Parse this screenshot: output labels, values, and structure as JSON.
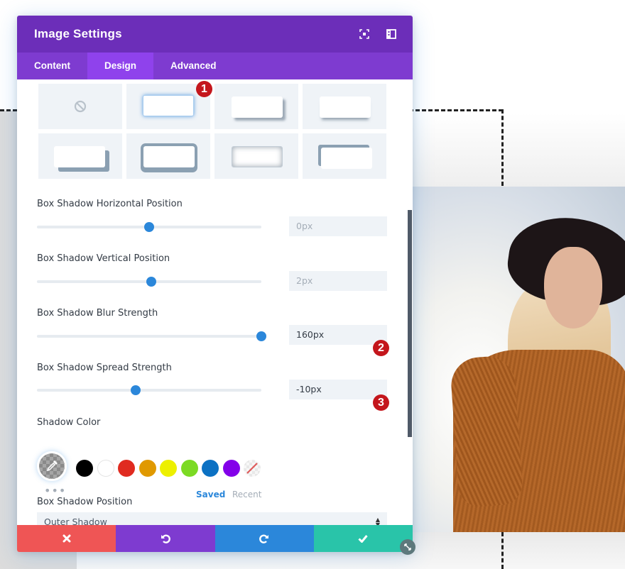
{
  "modal": {
    "title": "Image Settings",
    "header_icons": [
      "expand-icon",
      "split-view-icon"
    ],
    "tabs": [
      {
        "label": "Content",
        "active": false
      },
      {
        "label": "Design",
        "active": true
      },
      {
        "label": "Advanced",
        "active": false
      }
    ]
  },
  "box_shadow_presets": {
    "options": [
      "none",
      "glow",
      "drop-bottom-right",
      "drop-bottom",
      "solid-bottom-right",
      "solid-outline",
      "inset",
      "solid-top-left"
    ],
    "selected": "glow"
  },
  "annotations": [
    "1",
    "2",
    "3"
  ],
  "fields": {
    "horizontal": {
      "label": "Box Shadow Horizontal Position",
      "value": "0px",
      "slider_fraction": 0.5
    },
    "vertical": {
      "label": "Box Shadow Vertical Position",
      "value": "2px",
      "slider_fraction": 0.51
    },
    "blur": {
      "label": "Box Shadow Blur Strength",
      "value": "160px",
      "slider_fraction": 1.0
    },
    "spread": {
      "label": "Box Shadow Spread Strength",
      "value": "-10px",
      "slider_fraction": 0.44
    }
  },
  "shadow_color": {
    "label": "Shadow Color",
    "swatches": [
      {
        "name": "black",
        "color": "#000000"
      },
      {
        "name": "white",
        "color": "#ffffff"
      },
      {
        "name": "red",
        "color": "#e02b20"
      },
      {
        "name": "orange",
        "color": "#e09900"
      },
      {
        "name": "yellow",
        "color": "#edf000"
      },
      {
        "name": "green",
        "color": "#7cda24"
      },
      {
        "name": "blue",
        "color": "#0c71c3"
      },
      {
        "name": "purple",
        "color": "#8300e9"
      },
      {
        "name": "transparent",
        "color": "none"
      }
    ],
    "more_label": "•••",
    "palette_tabs": {
      "saved": "Saved",
      "recent": "Recent"
    }
  },
  "shadow_position": {
    "label": "Box Shadow Position",
    "selected": "Outer Shadow"
  },
  "footer": {
    "cancel": "cancel-icon",
    "undo": "undo-icon",
    "redo": "redo-icon",
    "save": "check-icon"
  },
  "colors": {
    "header": "#6c2eb9",
    "tabs": "#7e3bd0",
    "active_tab": "#8f42ec",
    "accent_blue": "#2b87da",
    "cancel": "#ef5555",
    "save": "#29c4a9",
    "badge": "#c4161c"
  }
}
